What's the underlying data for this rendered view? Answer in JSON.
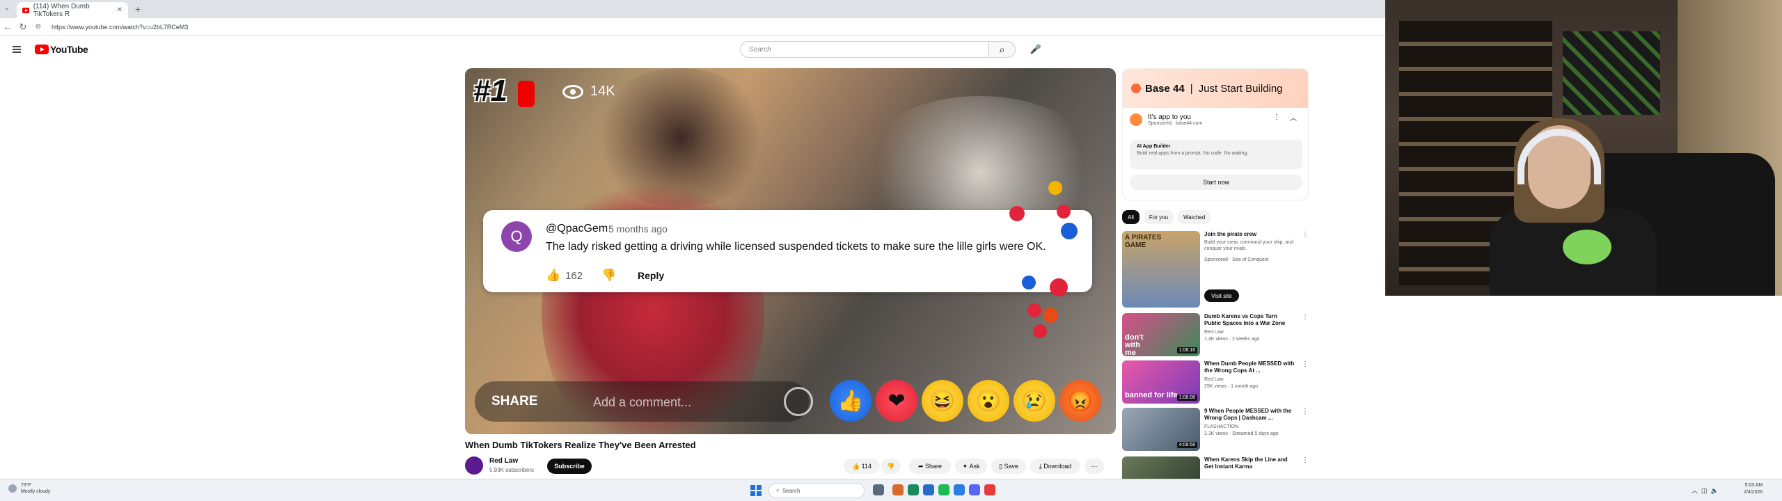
{
  "browser": {
    "tab_title": "(114) When Dumb TikTokers R",
    "url": "https://www.youtube.com/watch?v=u2bL7RCeM3"
  },
  "header": {
    "logo_text": "YouTube",
    "search_placeholder": "Search"
  },
  "player": {
    "rank": "#1",
    "views": "14K",
    "comment": {
      "avatar_letter": "Q",
      "user": "@QpacGem",
      "time": "5 months ago",
      "text": "The lady risked getting a driving while licensed suspended tickets to make sure the lille girls were OK.",
      "likes": "162",
      "reply_label": "Reply"
    },
    "share_label": "SHARE",
    "comment_placeholder": "Add a comment..."
  },
  "video": {
    "title": "When Dumb TikTokers Realize They've Been Arrested",
    "channel": "Red Law",
    "subscribers": "5.93K subscribers",
    "subscribe_label": "Subscribe",
    "actions": {
      "likes": "114",
      "share": "Share",
      "ask": "Ask",
      "save": "Save",
      "download": "Download"
    }
  },
  "ad": {
    "brand": "Base 44",
    "tagline": "Just Start Building",
    "headline": "It's app to you",
    "sponsored": "Sponsored · base44.com",
    "card_title": "AI App Builder",
    "card_sub": "Build real apps from a prompt. No code. No waiting.",
    "cta": "Start now"
  },
  "chips": [
    "All",
    "For you",
    "Watched"
  ],
  "recommendations": [
    {
      "title": "Join the pirate crew",
      "channel": "Build your crew, command your ship, and conquer your rivals.",
      "meta": "Sponsored · Sea of Conquest",
      "thumb_text": "A PIRATES GAME",
      "duration": "",
      "cta": "Visit site"
    },
    {
      "title": "Dumb Karens vs Cops Turn Public Spaces Into a War Zone",
      "channel": "Red Law",
      "meta": "1.4K views · 2 weeks ago",
      "thumb_text": "don't with me",
      "duration": "1:08:16",
      "cta": ""
    },
    {
      "title": "When Dumb People MESSED with the Wrong Cops At ...",
      "channel": "Red Law",
      "meta": "29K views · 1 month ago",
      "thumb_text": "banned for life",
      "duration": "1:08:08",
      "cta": ""
    },
    {
      "title": "9 When People MESSED with the Wrong Cops | Dashcam ...",
      "channel": "FLASHACTION",
      "meta": "2.3K views · Streamed 5 days ago",
      "thumb_text": "",
      "duration": "4:09:58",
      "cta": ""
    },
    {
      "title": "When Karens Skip the Line and Get Instant Karma",
      "channel": "",
      "meta": "",
      "thumb_text": "",
      "duration": "",
      "cta": ""
    }
  ],
  "taskbar": {
    "temp": "73°F",
    "weather": "Mostly cloudy",
    "search": "Search",
    "time": "5:03 AM",
    "date": "2/4/2026"
  }
}
